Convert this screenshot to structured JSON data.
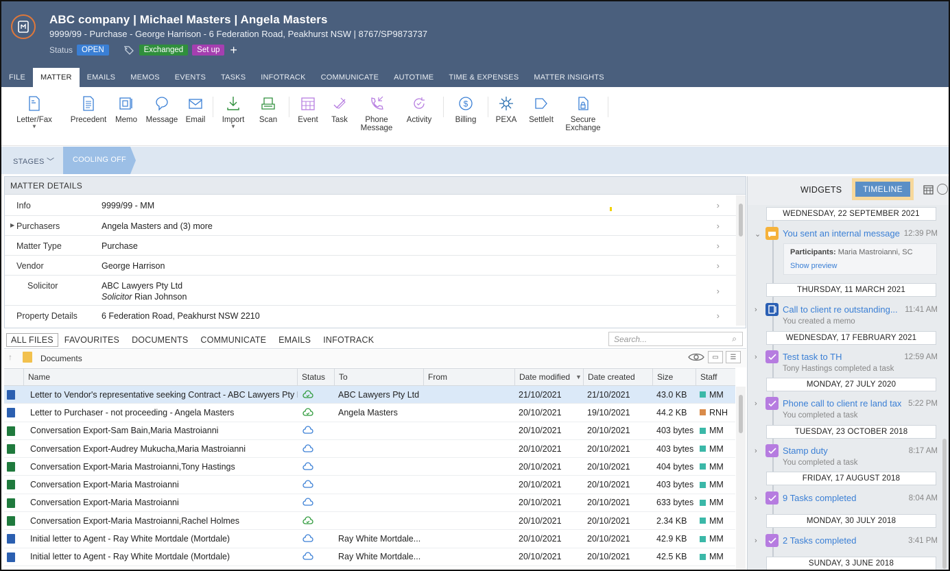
{
  "header": {
    "title": "ABC company | Michael Masters | Angela Masters",
    "subtitle": "9999/99 - Purchase - George Harrison - 6 Federation Road, Peakhurst NSW | 8767/SP9873737",
    "status_label": "Status",
    "status_value": "OPEN",
    "tags": [
      "Exchanged",
      "Set up"
    ],
    "add_label": "+"
  },
  "tabs": [
    "FILE",
    "MATTER",
    "EMAILS",
    "MEMOS",
    "EVENTS",
    "TASKS",
    "INFOTRACK",
    "COMMUNICATE",
    "AUTOTIME",
    "TIME & EXPENSES",
    "MATTER INSIGHTS"
  ],
  "ribbon": [
    {
      "l1": "Letter/Fax",
      "l2": "",
      "caret": true,
      "icon": "letter-icon"
    },
    {
      "l1": "Precedent",
      "l2": "",
      "icon": "precedent-icon"
    },
    {
      "l1": "Memo",
      "l2": "",
      "icon": "memo-icon"
    },
    {
      "l1": "Message",
      "l2": "",
      "icon": "message-icon"
    },
    {
      "l1": "Email",
      "l2": "",
      "icon": "email-icon"
    },
    {
      "l1": "Import",
      "l2": "",
      "caret": true,
      "icon": "import-icon"
    },
    {
      "l1": "Scan",
      "l2": "",
      "icon": "scan-icon"
    },
    {
      "l1": "Event",
      "l2": "",
      "icon": "event-icon"
    },
    {
      "l1": "Task",
      "l2": "",
      "icon": "task-icon"
    },
    {
      "l1": "Phone",
      "l2": "Message",
      "icon": "phone-icon"
    },
    {
      "l1": "Activity",
      "l2": "",
      "icon": "activity-icon"
    },
    {
      "l1": "Billing",
      "l2": "",
      "icon": "billing-icon"
    },
    {
      "l1": "PEXA",
      "l2": "",
      "icon": "pexa-icon"
    },
    {
      "l1": "SettleIt",
      "l2": "",
      "icon": "settleit-icon"
    },
    {
      "l1": "Secure",
      "l2": "Exchange",
      "icon": "secure-exchange-icon"
    }
  ],
  "stages": {
    "button": "STAGES",
    "current": "COOLING OFF"
  },
  "matter_details": {
    "title": "MATTER DETAILS",
    "rows": [
      {
        "key": "Info",
        "value": "9999/99 - MM"
      },
      {
        "key": "Purchasers",
        "value": "Angela Masters and (3) more"
      },
      {
        "key": "Matter Type",
        "value": "Purchase"
      },
      {
        "key": "Vendor",
        "value": "George Harrison"
      },
      {
        "key": "Solicitor",
        "value": "ABC Lawyers Pty Ltd",
        "sub_label": "Solicitor",
        "sub_value": "Rian Johnson"
      },
      {
        "key": "Property Details",
        "value": "6 Federation Road, Peakhurst NSW 2210"
      }
    ]
  },
  "file_tabs": [
    "ALL FILES",
    "FAVOURITES",
    "DOCUMENTS",
    "COMMUNICATE",
    "EMAILS",
    "INFOTRACK"
  ],
  "search_placeholder": "Search...",
  "folder": "Documents",
  "columns": [
    "Name",
    "Status",
    "To",
    "From",
    "Date modified",
    "Date created",
    "Size",
    "Staff"
  ],
  "files": [
    {
      "name": "Letter to Vendor's representative seeking Contract - ABC Lawyers Pty Ltd",
      "status": "synced",
      "to": "ABC Lawyers Pty Ltd",
      "from": "",
      "modified": "21/10/2021",
      "created": "21/10/2021",
      "size": "43.0 KB",
      "staff": "MM",
      "type": "word"
    },
    {
      "name": "Letter to Purchaser - not proceeding - Angela Masters",
      "status": "synced",
      "to": "Angela Masters",
      "from": "",
      "modified": "20/10/2021",
      "created": "19/10/2021",
      "size": "44.2 KB",
      "staff": "RNH",
      "type": "word"
    },
    {
      "name": "Conversation Export-Sam Bain,Maria Mastroianni",
      "status": "cloud",
      "to": "",
      "from": "",
      "modified": "20/10/2021",
      "created": "20/10/2021",
      "size": "403 bytes",
      "staff": "MM",
      "type": "excel"
    },
    {
      "name": "Conversation Export-Audrey Mukucha,Maria Mastroianni",
      "status": "cloud",
      "to": "",
      "from": "",
      "modified": "20/10/2021",
      "created": "20/10/2021",
      "size": "403 bytes",
      "staff": "MM",
      "type": "excel"
    },
    {
      "name": "Conversation Export-Maria Mastroianni,Tony Hastings",
      "status": "cloud",
      "to": "",
      "from": "",
      "modified": "20/10/2021",
      "created": "20/10/2021",
      "size": "404 bytes",
      "staff": "MM",
      "type": "excel"
    },
    {
      "name": "Conversation Export-Maria Mastroianni",
      "status": "cloud",
      "to": "",
      "from": "",
      "modified": "20/10/2021",
      "created": "20/10/2021",
      "size": "403 bytes",
      "staff": "MM",
      "type": "excel"
    },
    {
      "name": "Conversation Export-Maria Mastroianni",
      "status": "cloud",
      "to": "",
      "from": "",
      "modified": "20/10/2021",
      "created": "20/10/2021",
      "size": "633 bytes",
      "staff": "MM",
      "type": "excel"
    },
    {
      "name": "Conversation Export-Maria Mastroianni,Rachel Holmes",
      "status": "synced",
      "to": "",
      "from": "",
      "modified": "20/10/2021",
      "created": "20/10/2021",
      "size": "2.34 KB",
      "staff": "MM",
      "type": "excel"
    },
    {
      "name": "Initial letter to Agent - Ray White Mortdale (Mortdale)",
      "status": "cloud",
      "to": "Ray White Mortdale...",
      "from": "",
      "modified": "20/10/2021",
      "created": "20/10/2021",
      "size": "42.9 KB",
      "staff": "MM",
      "type": "word"
    },
    {
      "name": "Initial letter to Agent - Ray White Mortdale (Mortdale)",
      "status": "cloud",
      "to": "Ray White Mortdale...",
      "from": "",
      "modified": "20/10/2021",
      "created": "20/10/2021",
      "size": "42.5 KB",
      "staff": "MM",
      "type": "word"
    }
  ],
  "right_panel": {
    "widgets": "WIDGETS",
    "timeline": "TIMELINE"
  },
  "timeline": [
    {
      "date": "WEDNESDAY, 22 SEPTEMBER 2021",
      "title": "You sent an internal message",
      "time": "12:39 PM",
      "sub": "",
      "kind": "message",
      "participants_label": "Participants:",
      "participants": "Maria Mastroianni, SC",
      "preview": "Show preview"
    },
    {
      "date": "THURSDAY, 11 MARCH 2021",
      "title": "Call to client re outstanding...",
      "time": "11:41 AM",
      "sub": "You created a memo",
      "kind": "memo"
    },
    {
      "date": "WEDNESDAY, 17 FEBRUARY 2021",
      "title": "Test task to TH",
      "time": "12:59 AM",
      "sub": "Tony Hastings completed a task",
      "kind": "task"
    },
    {
      "date": "MONDAY, 27 JULY 2020",
      "title": "Phone call to client re land tax",
      "time": "5:22 PM",
      "sub": "You completed a task",
      "kind": "task"
    },
    {
      "date": "TUESDAY, 23 OCTOBER 2018",
      "title": "Stamp duty",
      "time": "8:17 AM",
      "sub": "You completed a task",
      "kind": "task"
    },
    {
      "date": "FRIDAY, 17 AUGUST 2018",
      "title": "9 Tasks completed",
      "time": "8:04 AM",
      "sub": "",
      "kind": "task"
    },
    {
      "date": "MONDAY, 30 JULY 2018",
      "title": "2 Tasks completed",
      "time": "3:41 PM",
      "sub": "",
      "kind": "task"
    },
    {
      "date": "SUNDAY, 3 JUNE 2018",
      "title": "",
      "time": "",
      "sub": "",
      "kind": ""
    }
  ],
  "colors": {
    "header": "#4a5f7d",
    "open": "#3a7fd5",
    "exchanged": "#2f8f3c",
    "setup": "#a53fb0",
    "timeline_active": "#5b8fc6",
    "task": "#b67ce0",
    "memo": "#2a5fb4",
    "message": "#f5b23b",
    "staff_mm": "#3bb8a8",
    "staff_rnh": "#d98b4a"
  }
}
